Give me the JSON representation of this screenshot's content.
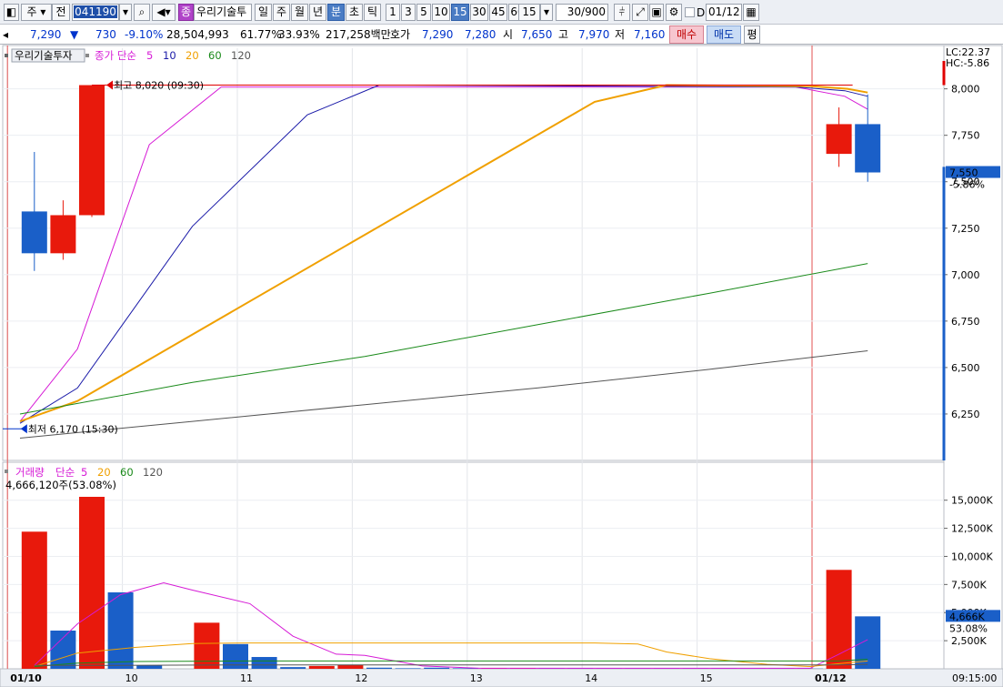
{
  "toolbar": {
    "period_select": "주",
    "prev_label": "전",
    "stock_code": "041190",
    "stock_name": "우리기술투",
    "stock_badge": "종",
    "periods": [
      "일",
      "주",
      "월",
      "년",
      "분",
      "초",
      "틱"
    ],
    "active_period": "분",
    "intervals": [
      "1",
      "3",
      "5",
      "10",
      "15",
      "30",
      "45",
      "60"
    ],
    "active_interval": "15",
    "interval_select": "15",
    "count_value": "30",
    "count_total": "/900",
    "checkbox_label": "D",
    "date_value": "01/12"
  },
  "infobar": {
    "price": "7,290",
    "direction": "▼",
    "change": "730",
    "change_pct": "-9.10%",
    "volume": "28,504,993",
    "pct1": "61.77%",
    "pct2": "33.93%",
    "amount": "217,258백만",
    "quote_label": "호가",
    "ask": "7,290",
    "bid": "7,280",
    "open_label": "시",
    "open": "7,650",
    "high_label": "고",
    "high": "7,970",
    "low_label": "저",
    "low": "7,160",
    "buy_label": "매수",
    "sell_label": "매도",
    "avg_label": "평"
  },
  "chart_data": [
    {
      "type": "candlestick",
      "legend": {
        "name": "우리기술투자",
        "ma_label": "종가 단순",
        "periods": [
          "5",
          "10",
          "20",
          "60",
          "120"
        ],
        "colors": [
          "#d61ad6",
          "#1a1aa8",
          "#f0a000",
          "#1a8a1a",
          "#555555"
        ]
      },
      "ylim": [
        6000,
        8150
      ],
      "yticks": [
        "8,000",
        "7,750",
        "7,500",
        "7,250",
        "7,000",
        "6,750",
        "6,500",
        "6,250"
      ],
      "right_labels": {
        "lc": "LC:22.37",
        "hc": "HC:-5.86",
        "current": "7,550",
        "current_pct": "-5.86%"
      },
      "annotations": {
        "high": "최고 8,020 (09:30)",
        "low": "최저 6,170 (15:30)"
      },
      "candles": [
        {
          "x": 0.5,
          "open": 7340,
          "close": 7115,
          "high": 7660,
          "low": 7020
        },
        {
          "x": 1.5,
          "open": 7115,
          "close": 7320,
          "high": 7400,
          "low": 7080
        },
        {
          "x": 2.5,
          "open": 7320,
          "close": 8020,
          "high": 8020,
          "low": 7310
        },
        {
          "x": 28.5,
          "open": 7650,
          "close": 7810,
          "high": 7900,
          "low": 7580
        },
        {
          "x": 29.5,
          "open": 7810,
          "close": 7550,
          "high": 7970,
          "low": 7500
        }
      ],
      "ma_series": [
        {
          "name": "5",
          "points": [
            [
              0,
              6210
            ],
            [
              2,
              6600
            ],
            [
              4.5,
              7700
            ],
            [
              7,
              8010
            ],
            [
              27,
              8010
            ],
            [
              28.7,
              7960
            ],
            [
              29.5,
              7890
            ]
          ]
        },
        {
          "name": "10",
          "points": [
            [
              0,
              6200
            ],
            [
              2,
              6390
            ],
            [
              6,
              7260
            ],
            [
              10,
              7860
            ],
            [
              12.5,
              8020
            ],
            [
              27,
              8010
            ],
            [
              28.7,
              7990
            ],
            [
              29.5,
              7960
            ]
          ]
        },
        {
          "name": "20",
          "points": [
            [
              0,
              6210
            ],
            [
              2,
              6320
            ],
            [
              20,
              7930
            ],
            [
              22.5,
              8020
            ],
            [
              27.5,
              8015
            ],
            [
              28.8,
              8000
            ],
            [
              29.5,
              7980
            ]
          ]
        },
        {
          "name": "60",
          "points": [
            [
              0,
              6250
            ],
            [
              6,
              6420
            ],
            [
              12,
              6560
            ],
            [
              18,
              6730
            ],
            [
              24,
              6900
            ],
            [
              29.5,
              7060
            ]
          ]
        },
        {
          "name": "120",
          "points": [
            [
              0,
              6120
            ],
            [
              6,
              6210
            ],
            [
              12,
              6300
            ],
            [
              18,
              6390
            ],
            [
              24,
              6490
            ],
            [
              29.5,
              6590
            ]
          ]
        }
      ]
    },
    {
      "type": "bar",
      "legend": {
        "name": "거래량",
        "ma_label": "단순",
        "periods": [
          "5",
          "20",
          "60",
          "120"
        ],
        "colors": [
          "#d61ad6",
          "#f0a000",
          "#1a8a1a",
          "#555555"
        ]
      },
      "summary": "4,666,120주(53.08%)",
      "ylim": [
        0,
        17000
      ],
      "yticks": [
        "15,000K",
        "12,500K",
        "10,000K",
        "7,500K",
        "5,000K",
        "2,500K"
      ],
      "right_labels": {
        "current": "4,666K",
        "current_pct": "53.08%"
      },
      "bars": [
        {
          "x": 0.5,
          "value": 12200,
          "color": "red"
        },
        {
          "x": 1.5,
          "value": 3400,
          "color": "blue"
        },
        {
          "x": 2.5,
          "value": 15300,
          "color": "red"
        },
        {
          "x": 3.5,
          "value": 6800,
          "color": "blue"
        },
        {
          "x": 4.5,
          "value": 300,
          "color": "blue"
        },
        {
          "x": 5.5,
          "value": 0,
          "color": "blue"
        },
        {
          "x": 6.5,
          "value": 4100,
          "color": "red"
        },
        {
          "x": 7.5,
          "value": 2200,
          "color": "blue"
        },
        {
          "x": 8.5,
          "value": 1050,
          "color": "blue"
        },
        {
          "x": 9.5,
          "value": 150,
          "color": "blue"
        },
        {
          "x": 10.5,
          "value": 250,
          "color": "red"
        },
        {
          "x": 11.5,
          "value": 350,
          "color": "red"
        },
        {
          "x": 12.5,
          "value": 100,
          "color": "blue"
        },
        {
          "x": 13.5,
          "value": 50,
          "color": "blue"
        },
        {
          "x": 14.5,
          "value": 100,
          "color": "blue"
        },
        {
          "x": 15.5,
          "value": 50,
          "color": "blue"
        },
        {
          "x": 16.5,
          "value": 80,
          "color": "red"
        },
        {
          "x": 17.5,
          "value": 50,
          "color": "red"
        },
        {
          "x": 18.5,
          "value": 30,
          "color": "blue"
        },
        {
          "x": 19.5,
          "value": 30,
          "color": "blue"
        },
        {
          "x": 20.5,
          "value": 20,
          "color": "blue"
        },
        {
          "x": 21.5,
          "value": 20,
          "color": "blue"
        },
        {
          "x": 22.5,
          "value": 20,
          "color": "blue"
        },
        {
          "x": 23.5,
          "value": 20,
          "color": "blue"
        },
        {
          "x": 24.5,
          "value": 20,
          "color": "blue"
        },
        {
          "x": 25.5,
          "value": 20,
          "color": "blue"
        },
        {
          "x": 26.5,
          "value": 20,
          "color": "blue"
        },
        {
          "x": 27.5,
          "value": 20,
          "color": "blue"
        },
        {
          "x": 28.5,
          "value": 8800,
          "color": "red"
        },
        {
          "x": 29.5,
          "value": 4666,
          "color": "blue"
        }
      ],
      "ma_series": [
        {
          "name": "5",
          "points": [
            [
              0.5,
              300
            ],
            [
              2,
              4000
            ],
            [
              3.5,
              6600
            ],
            [
              5,
              7650
            ],
            [
              6,
              7000
            ],
            [
              8,
              5800
            ],
            [
              9.5,
              2900
            ],
            [
              11,
              1300
            ],
            [
              12,
              1200
            ],
            [
              14,
              250
            ],
            [
              16,
              50
            ],
            [
              27.5,
              50
            ],
            [
              28.5,
              1300
            ],
            [
              29.5,
              2600
            ]
          ]
        },
        {
          "name": "20",
          "points": [
            [
              0.5,
              200
            ],
            [
              2,
              1400
            ],
            [
              4,
              1900
            ],
            [
              6,
              2250
            ],
            [
              8,
              2300
            ],
            [
              20,
              2300
            ],
            [
              21.5,
              2200
            ],
            [
              22.5,
              1500
            ],
            [
              24,
              900
            ],
            [
              26,
              400
            ],
            [
              27.5,
              200
            ],
            [
              28.5,
              450
            ],
            [
              29.5,
              700
            ]
          ]
        },
        {
          "name": "60",
          "points": [
            [
              0.5,
              200
            ],
            [
              2,
              500
            ],
            [
              4,
              650
            ],
            [
              8,
              700
            ],
            [
              28.5,
              700
            ],
            [
              29.5,
              850
            ]
          ]
        },
        {
          "name": "120",
          "points": [
            [
              0.5,
              300
            ],
            [
              3,
              300
            ],
            [
              8,
              350
            ],
            [
              28.5,
              350
            ],
            [
              29.5,
              400
            ]
          ]
        }
      ]
    }
  ],
  "x_axis": {
    "labels": [
      {
        "x": 0,
        "text": "01/10",
        "bold": true
      },
      {
        "x": 4,
        "text": "10"
      },
      {
        "x": 8,
        "text": "11"
      },
      {
        "x": 12,
        "text": "12"
      },
      {
        "x": 16,
        "text": "13"
      },
      {
        "x": 20,
        "text": "14"
      },
      {
        "x": 24,
        "text": "15"
      },
      {
        "x": 28,
        "text": "01/12",
        "bold": true
      }
    ],
    "time": "09:15:00"
  }
}
